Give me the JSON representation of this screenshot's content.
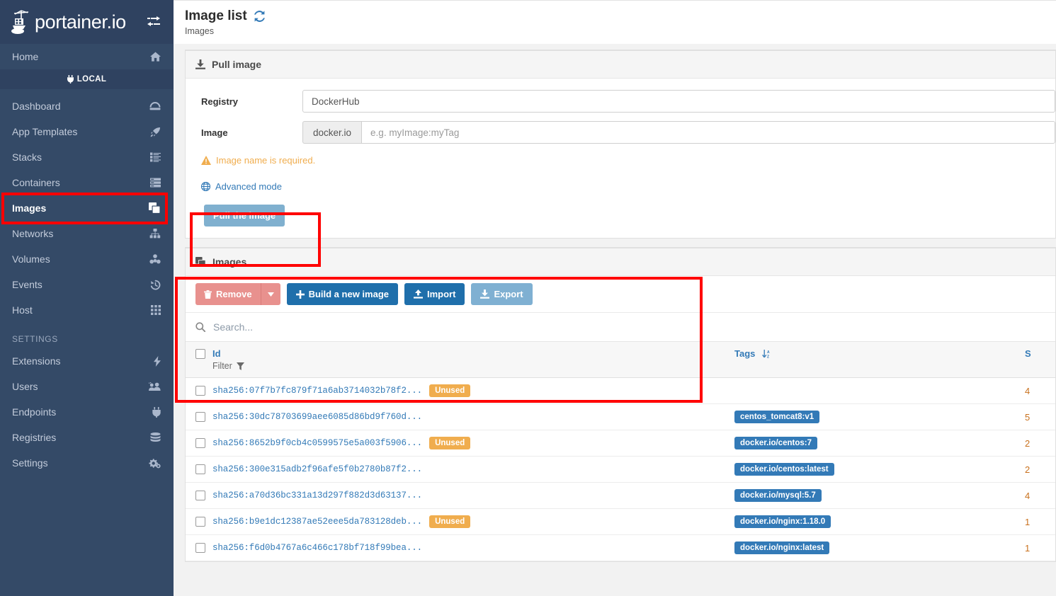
{
  "sidebar": {
    "brand": "portainer.io",
    "toggle_icon": "toggle-sidebar-icon",
    "home": {
      "label": "Home",
      "icon": "home-icon"
    },
    "endpoint_band": {
      "label": "LOCAL",
      "icon": "plug-icon"
    },
    "items": [
      {
        "label": "Dashboard",
        "icon": "dashboard-icon",
        "active": false
      },
      {
        "label": "App Templates",
        "icon": "rocket-icon",
        "active": false
      },
      {
        "label": "Stacks",
        "icon": "stacks-icon",
        "active": false
      },
      {
        "label": "Containers",
        "icon": "containers-icon",
        "active": false
      },
      {
        "label": "Images",
        "icon": "images-icon",
        "active": true
      },
      {
        "label": "Networks",
        "icon": "networks-icon",
        "active": false
      },
      {
        "label": "Volumes",
        "icon": "volumes-icon",
        "active": false
      },
      {
        "label": "Events",
        "icon": "history-icon",
        "active": false
      },
      {
        "label": "Host",
        "icon": "grid-icon",
        "active": false
      }
    ],
    "settings_section": "SETTINGS",
    "settings_items": [
      {
        "label": "Extensions",
        "icon": "bolt-icon"
      },
      {
        "label": "Users",
        "icon": "users-icon"
      },
      {
        "label": "Endpoints",
        "icon": "plug-icon"
      },
      {
        "label": "Registries",
        "icon": "database-icon"
      },
      {
        "label": "Settings",
        "icon": "gears-icon"
      }
    ]
  },
  "header": {
    "title": "Image list",
    "refresh_icon": "refresh-icon",
    "subtitle": "Images"
  },
  "pull_panel": {
    "title": "Pull image",
    "icon": "download-icon",
    "registry_label": "Registry",
    "registry_value": "DockerHub",
    "image_label": "Image",
    "image_addon": "docker.io",
    "image_placeholder": "e.g. myImage:myTag",
    "image_value": "",
    "warning": "Image name is required.",
    "warning_icon": "warning-icon",
    "advanced_mode": "Advanced mode",
    "advanced_icon": "globe-icon",
    "pull_button": "Pull the image"
  },
  "images_panel": {
    "title": "Images",
    "icon": "images-icon",
    "toolbar": {
      "remove": "Remove",
      "remove_icon": "trash-icon",
      "remove_caret_icon": "caret-down-icon",
      "build": "Build a new image",
      "build_icon": "plus-icon",
      "import": "Import",
      "import_icon": "upload-icon",
      "export": "Export",
      "export_icon": "download-icon"
    },
    "search": {
      "placeholder": "Search...",
      "value": "",
      "icon": "search-icon"
    },
    "columns": {
      "id": "Id",
      "tags": "Tags",
      "size": "S",
      "tags_sort_icon": "sort-alpha-down-icon",
      "filter_label": "Filter",
      "filter_icon": "funnel-icon"
    },
    "rows": [
      {
        "id": "sha256:07f7b7fc879f71a6ab3714032b78f2...",
        "unused": "Unused",
        "tags": [],
        "size": "4"
      },
      {
        "id": "sha256:30dc78703699aee6085d86bd9f760d...",
        "unused": "",
        "tags": [
          "centos_tomcat8:v1"
        ],
        "size": "5"
      },
      {
        "id": "sha256:8652b9f0cb4c0599575e5a003f5906...",
        "unused": "Unused",
        "tags": [
          "docker.io/centos:7"
        ],
        "size": "2"
      },
      {
        "id": "sha256:300e315adb2f96afe5f0b2780b87f2...",
        "unused": "",
        "tags": [
          "docker.io/centos:latest"
        ],
        "size": "2"
      },
      {
        "id": "sha256:a70d36bc331a13d297f882d3d63137...",
        "unused": "",
        "tags": [
          "docker.io/mysql:5.7"
        ],
        "size": "4"
      },
      {
        "id": "sha256:b9e1dc12387ae52eee5da783128deb...",
        "unused": "Unused",
        "tags": [
          "docker.io/nginx:1.18.0"
        ],
        "size": "1"
      },
      {
        "id": "sha256:f6d0b4767a6c466c178bf718f99bea...",
        "unused": "",
        "tags": [
          "docker.io/nginx:latest"
        ],
        "size": "1"
      }
    ]
  },
  "annotations": [
    {
      "name": "images-nav-highlight",
      "color": "#ff0000"
    },
    {
      "name": "pull-button-highlight",
      "color": "#ff0000"
    },
    {
      "name": "images-panel-highlight",
      "color": "#ff0000"
    }
  ]
}
